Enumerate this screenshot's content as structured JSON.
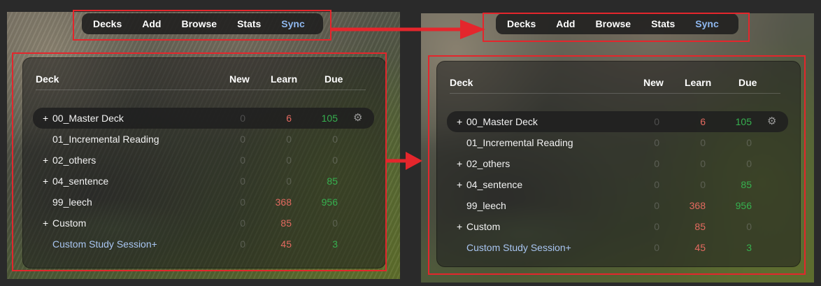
{
  "nav": {
    "decks": "Decks",
    "add": "Add",
    "browse": "Browse",
    "stats": "Stats",
    "sync": "Sync"
  },
  "table": {
    "headers": {
      "deck": "Deck",
      "new": "New",
      "learn": "Learn",
      "due": "Due"
    },
    "rows": [
      {
        "toggle": "+",
        "name": "00_Master Deck",
        "new": "0",
        "learn": "6",
        "due": "105"
      },
      {
        "toggle": "",
        "name": "01_Incremental Reading",
        "new": "0",
        "learn": "0",
        "due": "0"
      },
      {
        "toggle": "+",
        "name": "02_others",
        "new": "0",
        "learn": "0",
        "due": "0"
      },
      {
        "toggle": "+",
        "name": "04_sentence",
        "new": "0",
        "learn": "0",
        "due": "85"
      },
      {
        "toggle": "",
        "name": "99_leech",
        "new": "0",
        "learn": "368",
        "due": "956"
      },
      {
        "toggle": "+",
        "name": "Custom",
        "new": "0",
        "learn": "85",
        "due": "0"
      },
      {
        "toggle": "",
        "name": "Custom Study Session+",
        "new": "0",
        "learn": "45",
        "due": "3"
      }
    ]
  },
  "icons": {
    "gear": "gear-icon",
    "arrow": "right-arrow-icon"
  },
  "colors": {
    "highlight_box": "#e4262c",
    "learn_count": "#e46a60",
    "due_count": "#36b04f",
    "filtered_deck": "#a9c6f2",
    "sync_link": "#8fb8f0"
  }
}
